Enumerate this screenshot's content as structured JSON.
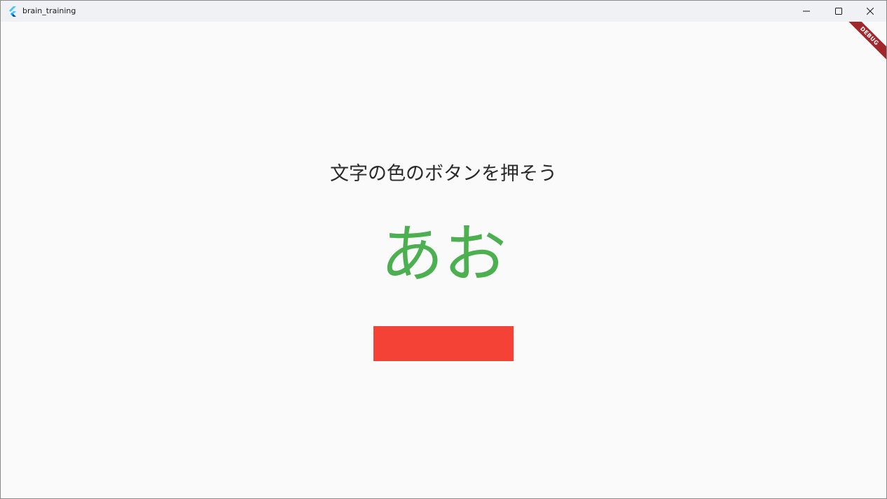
{
  "window": {
    "title": "brain_training",
    "app_icon": "flutter-logo-icon",
    "controls": {
      "minimize_icon": "minimize-icon",
      "maximize_icon": "maximize-icon",
      "close_icon": "close-icon"
    }
  },
  "main": {
    "prompt": "文字の色のボタンを押そう",
    "word": "あお",
    "word_color": "#4caf50",
    "button_color": "#f44336"
  },
  "debug_banner": {
    "label": "DEBUG",
    "color": "#a0282d"
  },
  "colors": {
    "background": "#fafafa",
    "titlebar": "#f0f1f4"
  }
}
